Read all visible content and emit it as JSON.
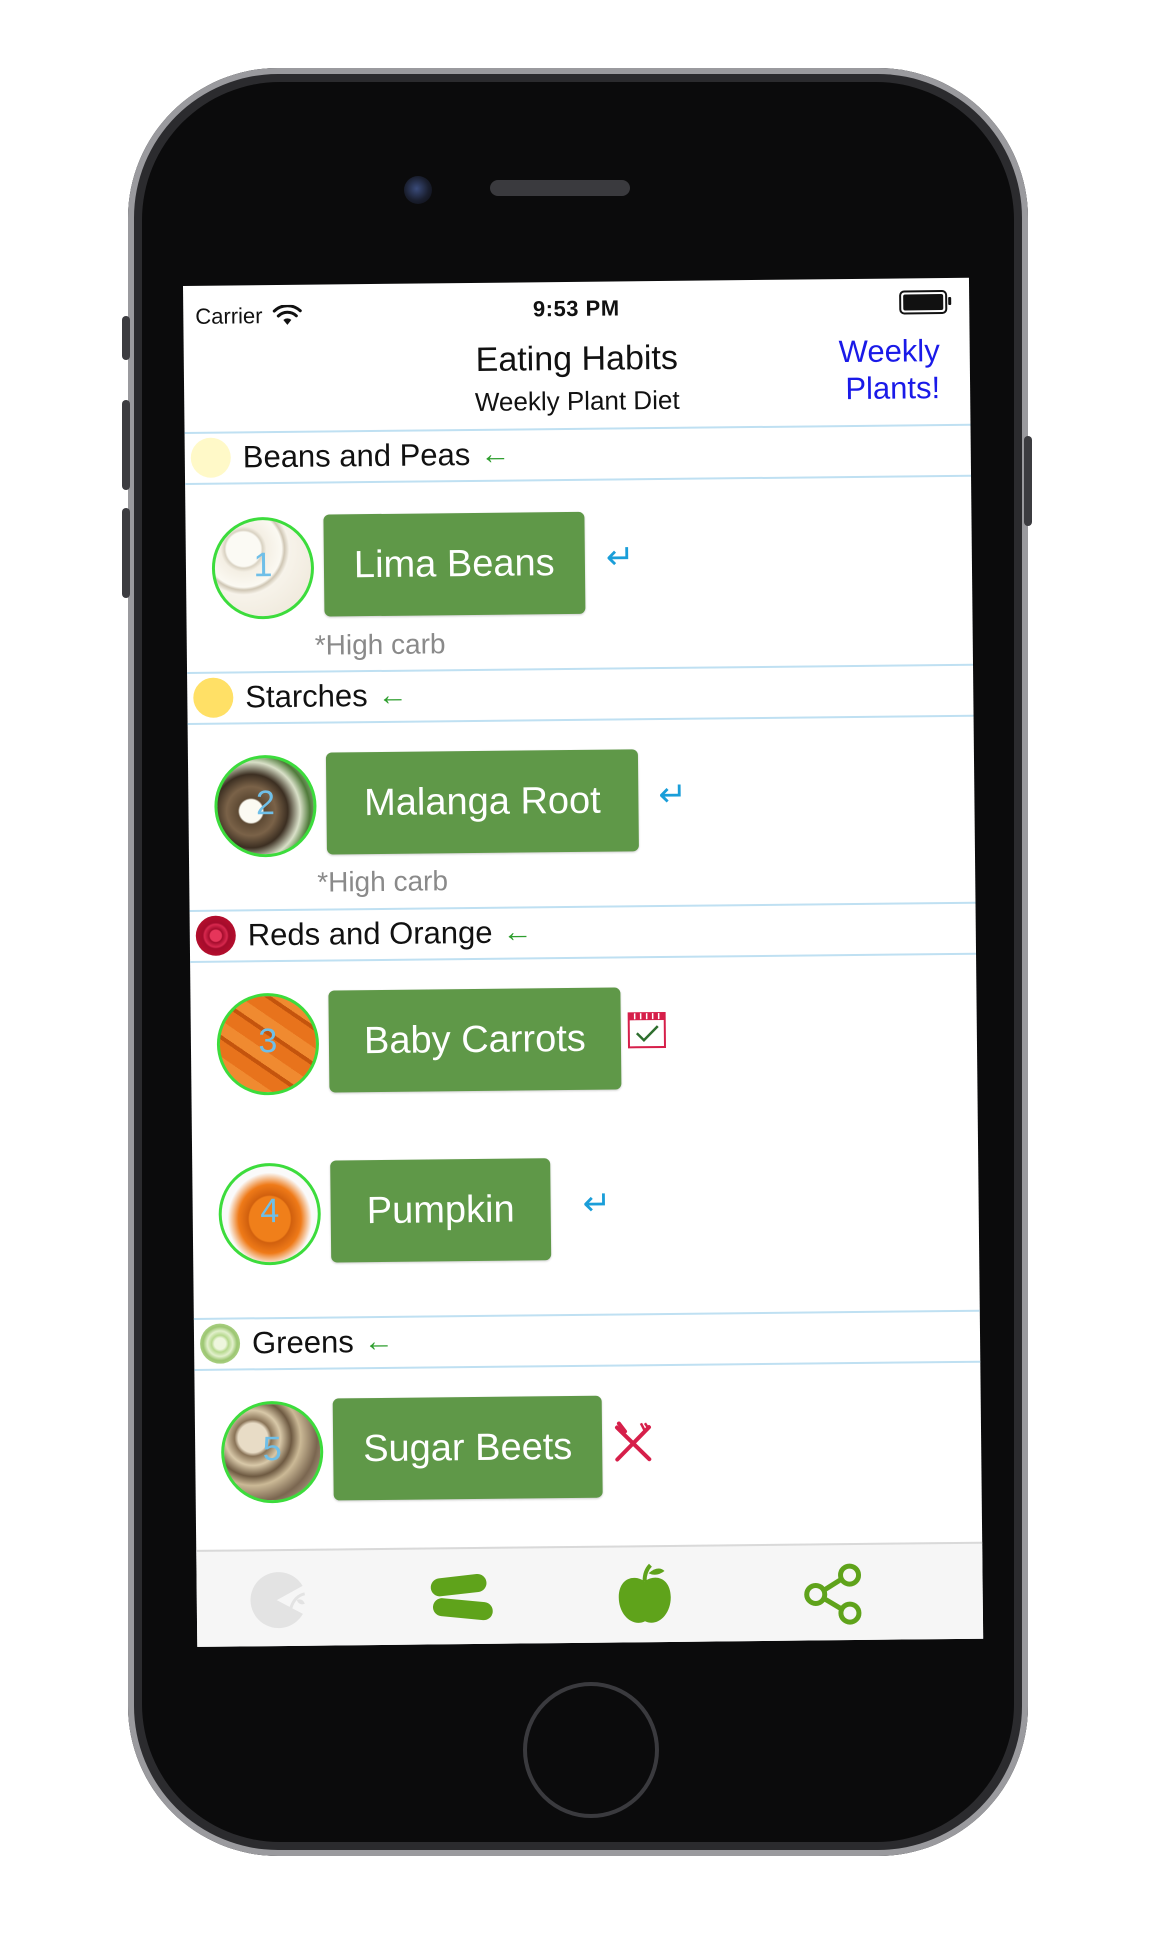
{
  "status_bar": {
    "carrier": "Carrier",
    "time": "9:53 PM"
  },
  "nav": {
    "title": "Eating Habits",
    "subtitle": "Weekly Plant Diet",
    "weekly_link": "Weekly Plants!"
  },
  "sections": [
    {
      "label": "Beans and Peas",
      "dot_color": "#fff9c8",
      "items": [
        {
          "number": "1",
          "name": "Lima Beans",
          "action_icon": "return-arrow-icon",
          "note": "*High carb"
        }
      ]
    },
    {
      "label": "Starches",
      "dot_color": "#ffe066",
      "items": [
        {
          "number": "2",
          "name": "Malanga Root",
          "action_icon": "return-arrow-icon",
          "note": "*High carb"
        }
      ]
    },
    {
      "label": "Reds and Orange",
      "dot_color": "#c8102e",
      "items": [
        {
          "number": "3",
          "name": "Baby Carrots",
          "action_icon": "calendar-check-icon"
        },
        {
          "number": "4",
          "name": "Pumpkin",
          "action_icon": "return-arrow-icon"
        }
      ]
    },
    {
      "label": "Greens",
      "dot_color": "#c9e7a8",
      "items": [
        {
          "number": "5",
          "name": "Sugar Beets",
          "action_icon": "fork-knife-cross-icon"
        }
      ]
    }
  ],
  "tab_bar": [
    {
      "icon": "pac-plant-icon",
      "active": false
    },
    {
      "icon": "cucumber-icon",
      "active": true
    },
    {
      "icon": "apple-icon",
      "active": true
    },
    {
      "icon": "share-icon",
      "active": true
    }
  ],
  "colors": {
    "accent_green": "#5f9848",
    "link_blue": "#1a1ae8",
    "return_blue": "#1a9ed9",
    "icon_red": "#d61f4a"
  }
}
